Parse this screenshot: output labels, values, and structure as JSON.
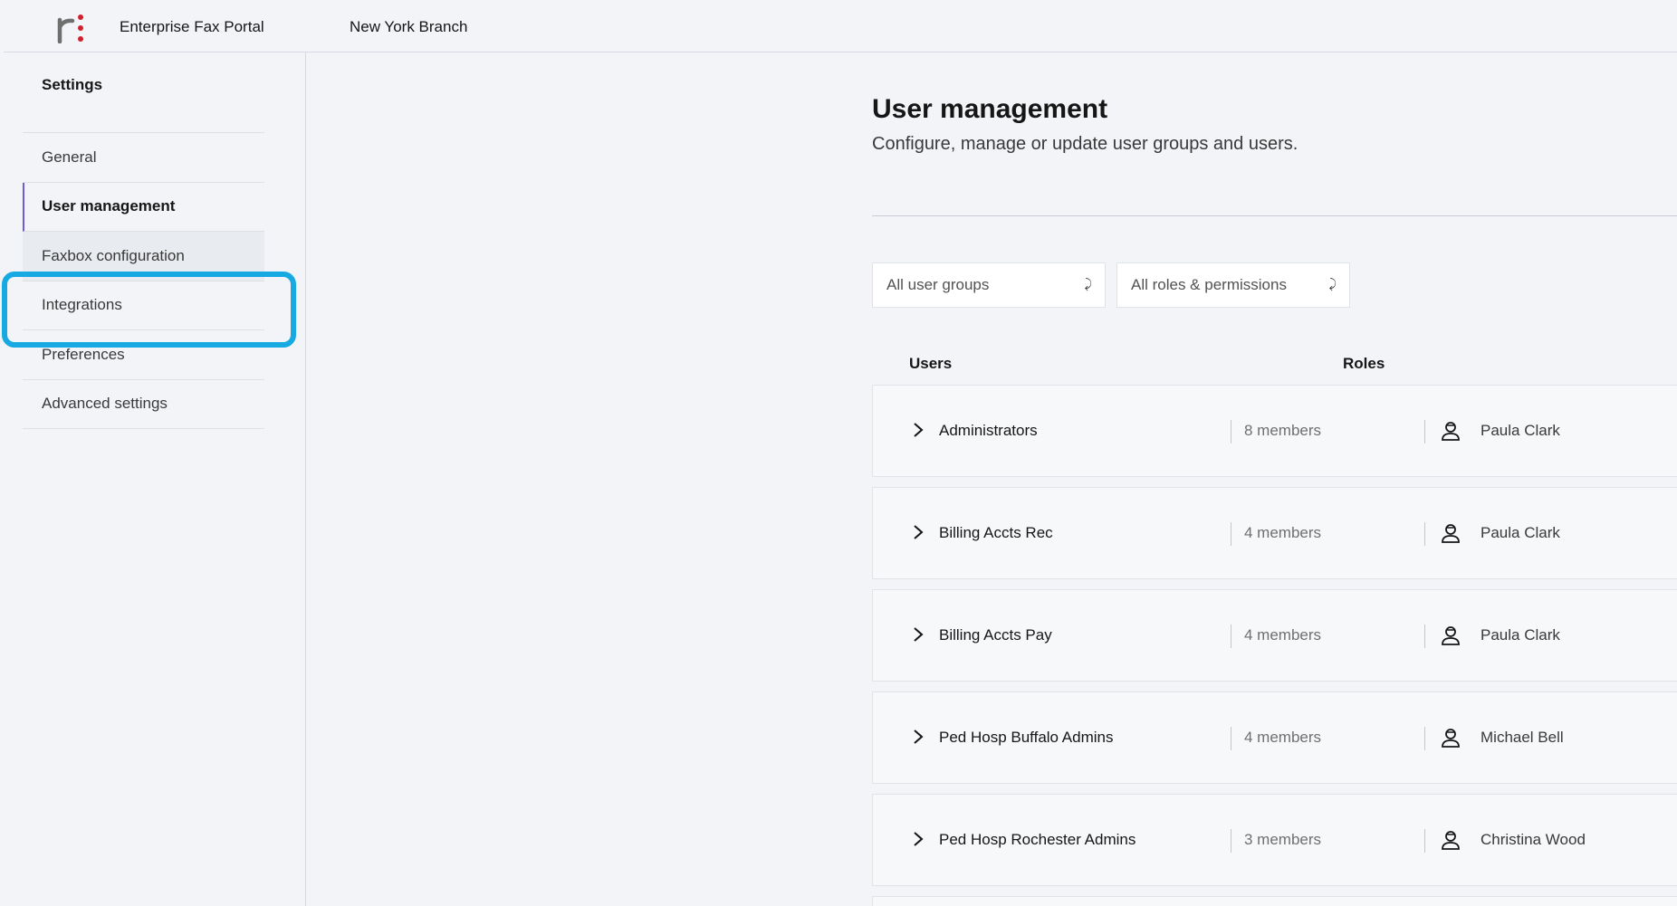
{
  "header": {
    "logo_icon": "brand-logo-icon",
    "app_title": "Enterprise Fax Portal",
    "branch": "New York Branch"
  },
  "sidebar": {
    "title": "Settings",
    "items": [
      {
        "label": "General"
      },
      {
        "label": "User management",
        "active": true
      },
      {
        "label": "Faxbox configuration",
        "highlighted": true
      },
      {
        "label": "Integrations"
      },
      {
        "label": "Preferences"
      },
      {
        "label": "Advanced settings"
      }
    ],
    "highlight_color": "#17a9e1",
    "active_indicator_color": "#6e5cd6"
  },
  "main": {
    "title": "User management",
    "subtitle": "Configure, manage or update user groups and users.",
    "filters": {
      "user_groups": "All user groups",
      "roles": "All roles & permissions"
    },
    "columns": {
      "users": "Users",
      "roles": "Roles"
    },
    "groups": [
      {
        "name": "Administrators",
        "members": "8 members",
        "owner": "Paula Clark"
      },
      {
        "name": "Billing Accts Rec",
        "members": "4 members",
        "owner": "Paula Clark"
      },
      {
        "name": "Billing Accts Pay",
        "members": "4 members",
        "owner": "Paula Clark"
      },
      {
        "name": "Ped Hosp Buffalo Admins",
        "members": "4 members",
        "owner": "Michael Bell"
      },
      {
        "name": "Ped Hosp Rochester Admins",
        "members": "3 members",
        "owner": "Christina Wood"
      }
    ]
  }
}
